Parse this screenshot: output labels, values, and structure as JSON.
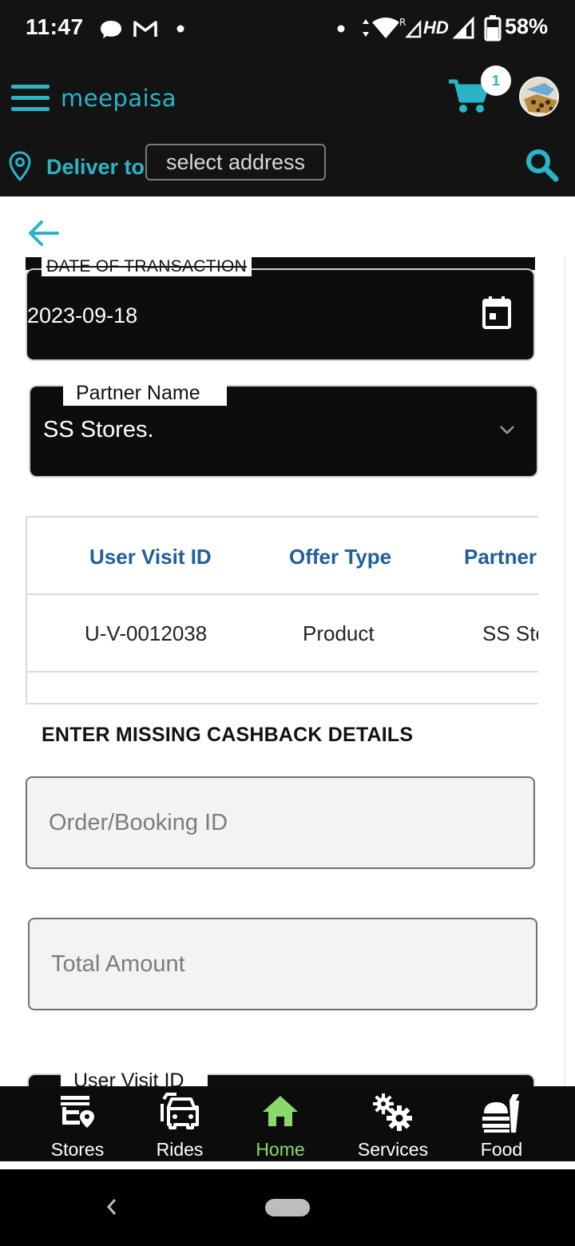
{
  "status_bar": {
    "time": "11:47",
    "network": "HD",
    "battery": "58%",
    "icons": [
      "chat-icon",
      "gmail-icon",
      "dot-icon",
      "data-arrows-icon",
      "wifi-icon",
      "signal-icon",
      "battery-icon"
    ]
  },
  "header": {
    "brand": "meepaisa",
    "cart_count": "1",
    "deliver_label": "Deliver to",
    "address_placeholder": "select address",
    "accent_color": "#2ab4c8"
  },
  "form": {
    "date_label": "DATE OF TRANSACTION",
    "date_value": "2023-09-18",
    "partner_label": "Partner Name",
    "partner_value": "SS Stores."
  },
  "table": {
    "headers": [
      "User Visit ID",
      "Offer Type",
      "Partner"
    ],
    "rows": [
      [
        "U-V-0012038",
        "Product",
        "SS Sto"
      ]
    ]
  },
  "cashback": {
    "title": "ENTER MISSING CASHBACK DETAILS",
    "order_placeholder": "Order/Booking ID",
    "amount_placeholder": "Total Amount",
    "user_visit_label": "User Visit ID"
  },
  "bottom_nav": {
    "items": [
      {
        "label": "Stores",
        "icon": "store-icon"
      },
      {
        "label": "Rides",
        "icon": "car-icon"
      },
      {
        "label": "Home",
        "icon": "home-icon",
        "active": true
      },
      {
        "label": "Services",
        "icon": "gears-icon"
      },
      {
        "label": "Food",
        "icon": "food-icon"
      }
    ],
    "active_color": "#8bd96a"
  }
}
